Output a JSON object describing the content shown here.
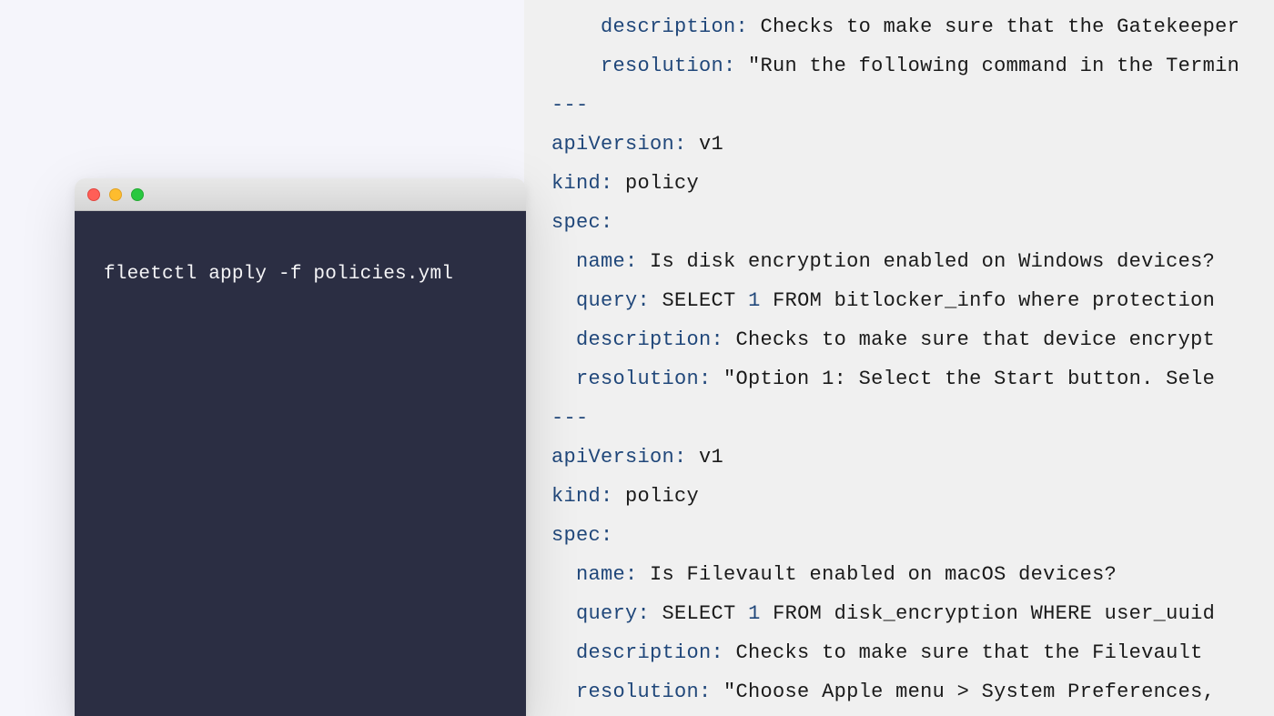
{
  "terminal": {
    "command": "fleetctl apply -f policies.yml"
  },
  "yaml": {
    "separator": "---",
    "indent1": "  ",
    "indent2": "    ",
    "blocks": [
      {
        "description_key": "description:",
        "description_val": " Checks to make sure that the Gatekeeper",
        "resolution_key": "resolution:",
        "resolution_val": " \"Run the following command in the Termin"
      },
      {
        "apiVersion_key": "apiVersion:",
        "apiVersion_val": " v1",
        "kind_key": "kind:",
        "kind_val": " policy",
        "spec_key": "spec:",
        "name_key": "name:",
        "name_val": " Is disk encryption enabled on Windows devices?",
        "query_key": "query:",
        "query_pre": " SELECT ",
        "query_num": "1",
        "query_post": " FROM bitlocker_info where protection",
        "description_key": "description:",
        "description_val": " Checks to make sure that device encrypt",
        "resolution_key": "resolution:",
        "resolution_val": " \"Option 1: Select the Start button. Sele"
      },
      {
        "apiVersion_key": "apiVersion:",
        "apiVersion_val": " v1",
        "kind_key": "kind:",
        "kind_val": " policy",
        "spec_key": "spec:",
        "name_key": "name:",
        "name_val": " Is Filevault enabled on macOS devices?",
        "query_key": "query:",
        "query_pre": " SELECT ",
        "query_num": "1",
        "query_post": " FROM disk_encryption WHERE user_uuid",
        "description_key": "description:",
        "description_val": " Checks to make sure that the Filevault ",
        "resolution_key": "resolution:",
        "resolution_val": " \"Choose Apple menu > System Preferences,"
      }
    ]
  }
}
